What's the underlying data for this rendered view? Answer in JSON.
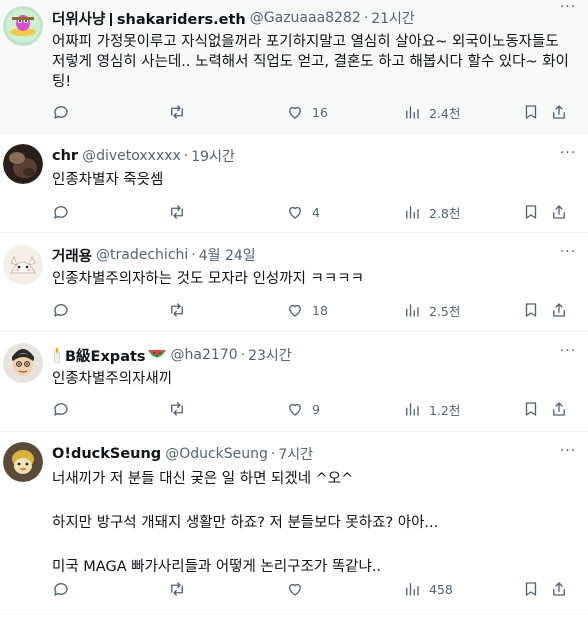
{
  "tweets": [
    {
      "name": "더위사냥",
      "name_suffix": "shakariders.eth",
      "handle": "@Gazuaaa8282",
      "time": "21시간",
      "lines": [
        "어짜피 가정못이루고 자식없을꺼라 포기하지말고 열심히 살아요~ 외국이노동자들도",
        "저렇게 영심히 사는데..  노력해서 직업도 얻고, 결혼도 하고 해봅시다 할수 있다~ 화이",
        "팅!"
      ],
      "replies": "",
      "retweets": "",
      "likes": "16",
      "views": "2.4천"
    },
    {
      "name": "chr",
      "handle": "@divetoxxxxx",
      "time": "19시간",
      "lines": [
        "인종차별자 죽읏셈"
      ],
      "likes": "4",
      "views": "2.8천"
    },
    {
      "name": "거래용",
      "handle": "@tradechichi",
      "time": "4월 24일",
      "lines": [
        "인종차별주의자하는 것도 모자라 인성까지 ㅋㅋㅋㅋ"
      ],
      "likes": "18",
      "views": "2.5천"
    },
    {
      "name": "B級Expats",
      "handle": "@ha2170",
      "time": "23시간",
      "lines": [
        "인종차별주의자새끼"
      ],
      "likes": "9",
      "views": "1.2천"
    },
    {
      "name": "O!duckSeung",
      "handle": "@OduckSeung",
      "time": "7시간",
      "lines": [
        "너새끼가 저 분들 대신 궂은 일 하면 되겠네 ^오^",
        "",
        "하지만 방구석 개돼지 생활만 하죠? 저 분들보다 못하죠? 아아...",
        "",
        "미국 MAGA 빠가사리들과 어떻게 논리구조가 똑같냐.."
      ],
      "likes": "",
      "views": "458"
    }
  ],
  "colors": {
    "text": "#0f1419",
    "muted": "#536471",
    "border": "#eff3f4",
    "highlight_bg": "#f7f9f9"
  }
}
